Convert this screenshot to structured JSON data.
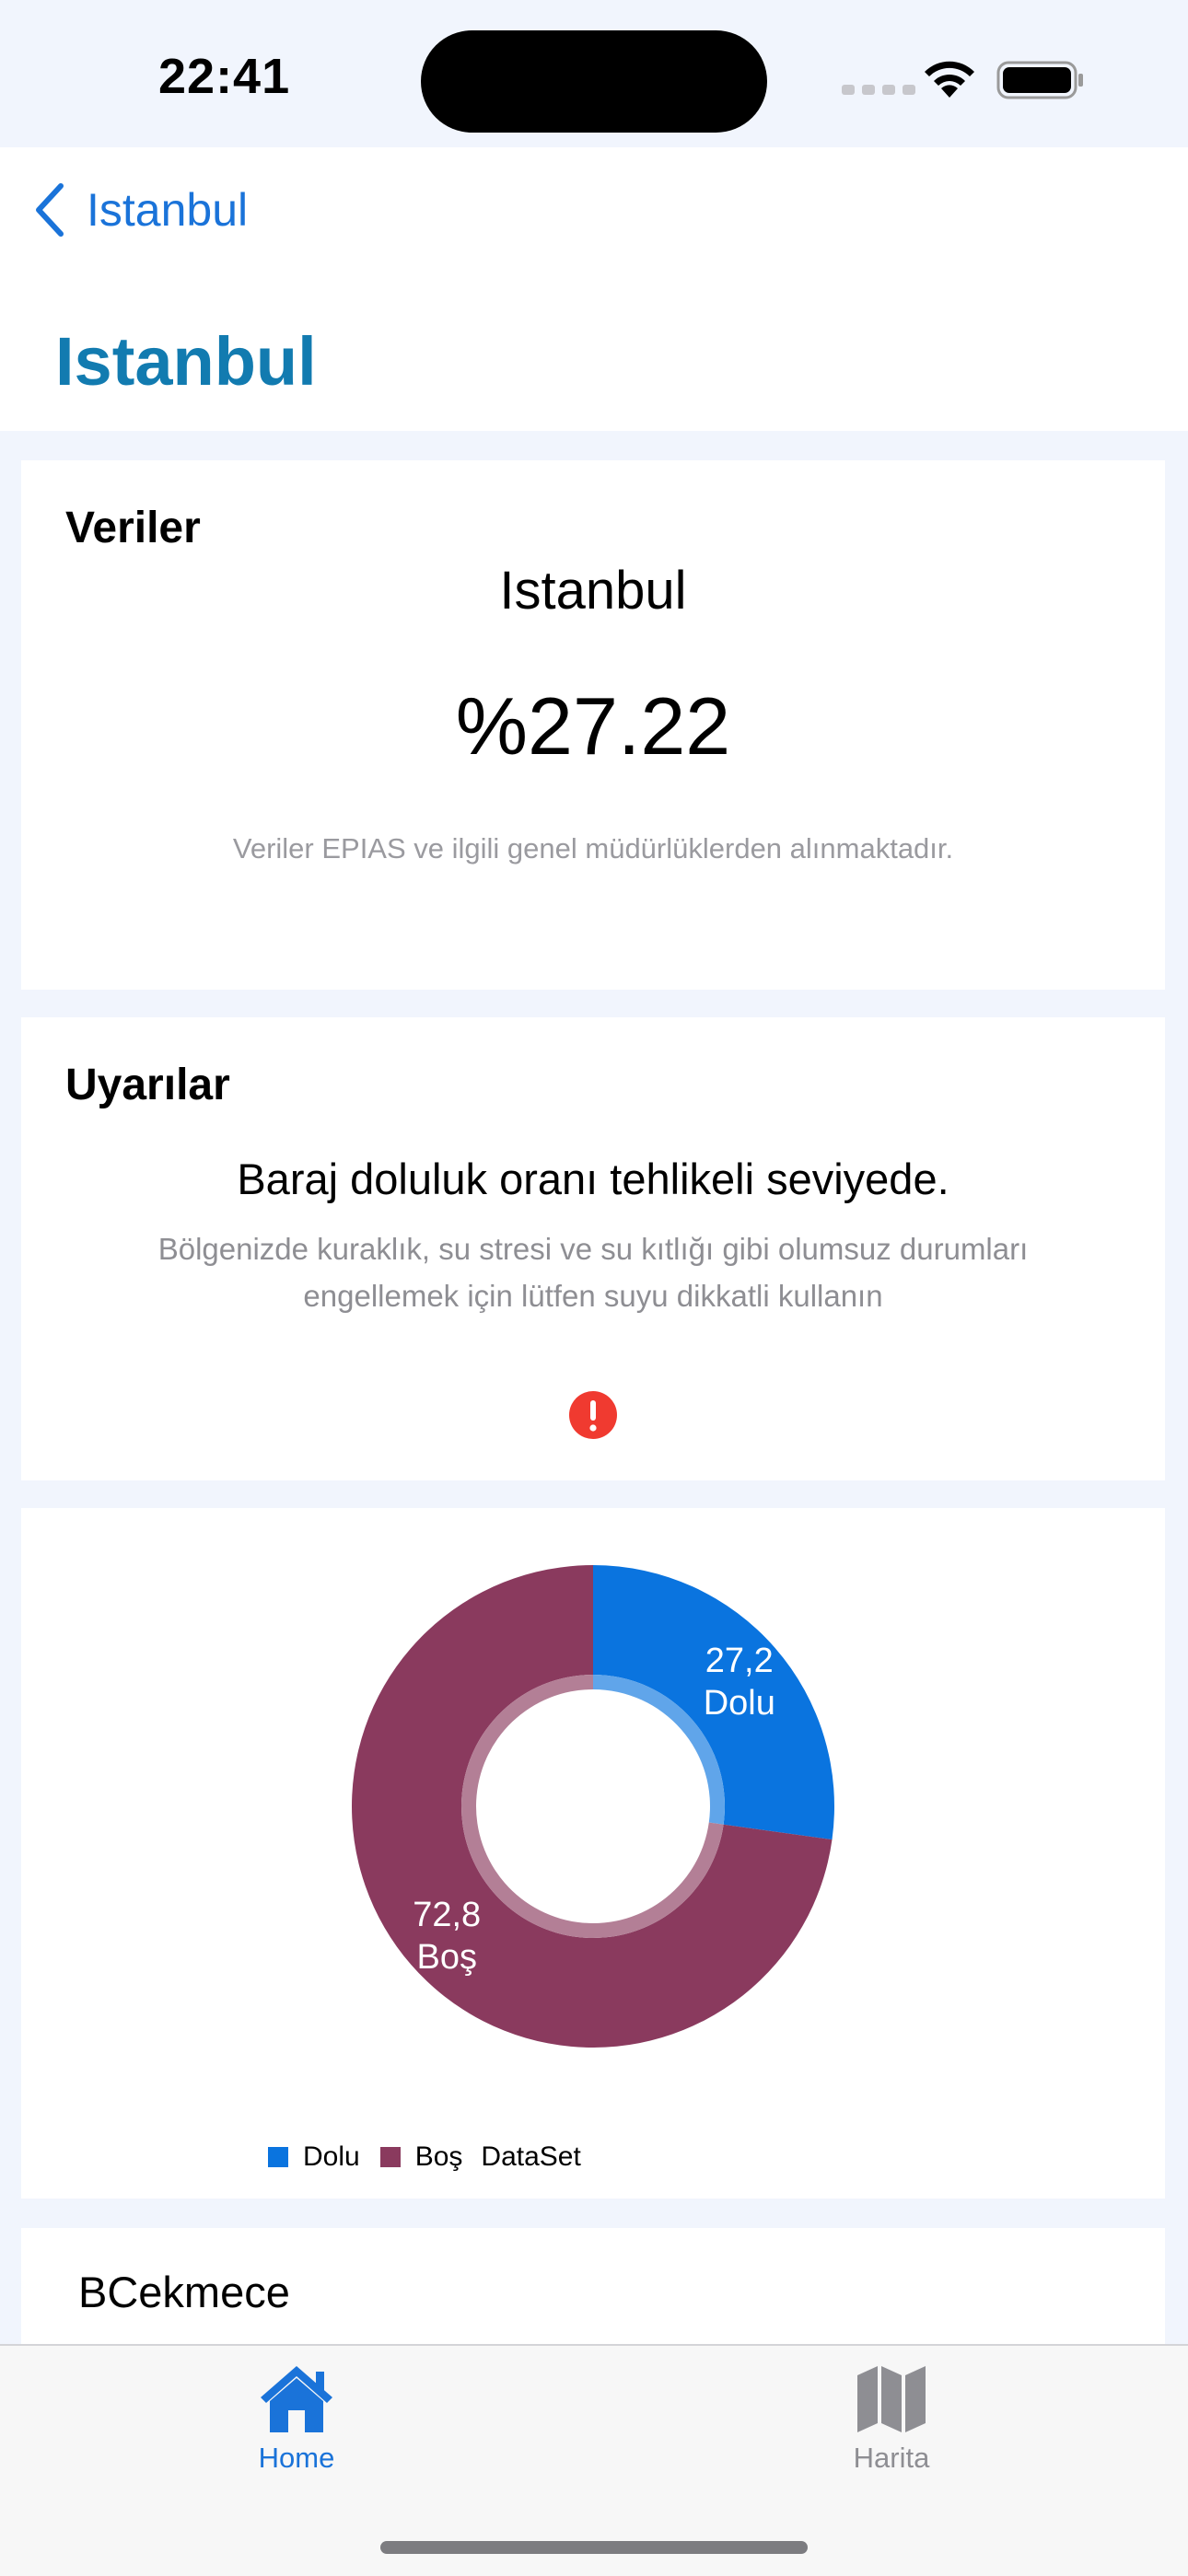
{
  "status_bar": {
    "time": "22:41"
  },
  "nav": {
    "back_label": "Istanbul",
    "title": "Istanbul"
  },
  "veriler": {
    "title": "Veriler",
    "city": "Istanbul",
    "percentage": "%27.22",
    "source_note": "Veriler EPIAS ve ilgili genel müdürlüklerden alınmaktadır."
  },
  "uyarilar": {
    "title": "Uyarılar",
    "headline": "Baraj doluluk oranı tehlikeli seviyede.",
    "body_line1": "Bölgenizde kuraklık, su stresi ve su kıtlığı gibi olumsuz durumları",
    "body_line2": "engellemek için lütfen suyu dikkatli kullanın",
    "icon": "exclamation-circle-icon",
    "icon_color": "#f03a30"
  },
  "chart_data": {
    "type": "pie",
    "slices": [
      {
        "label": "Dolu",
        "value": 27.2,
        "display": "27,2",
        "color": "#0a74df"
      },
      {
        "label": "Boş",
        "value": 72.8,
        "display": "72,8",
        "color": "#8a3a5e"
      }
    ],
    "legend": [
      {
        "label": "Dolu",
        "color": "#0a74df"
      },
      {
        "label": "Boş",
        "color": "#8a3a5e"
      }
    ],
    "dataset_label": "DataSet",
    "legend_position": "bottom-left"
  },
  "list": {
    "first_item": "BCekmece"
  },
  "tabbar": {
    "tabs": [
      {
        "label": "Home",
        "icon": "house-icon",
        "active": true,
        "color": "#1a73d9"
      },
      {
        "label": "Harita",
        "icon": "map-icon",
        "active": false,
        "color": "#8e8e93"
      }
    ]
  }
}
